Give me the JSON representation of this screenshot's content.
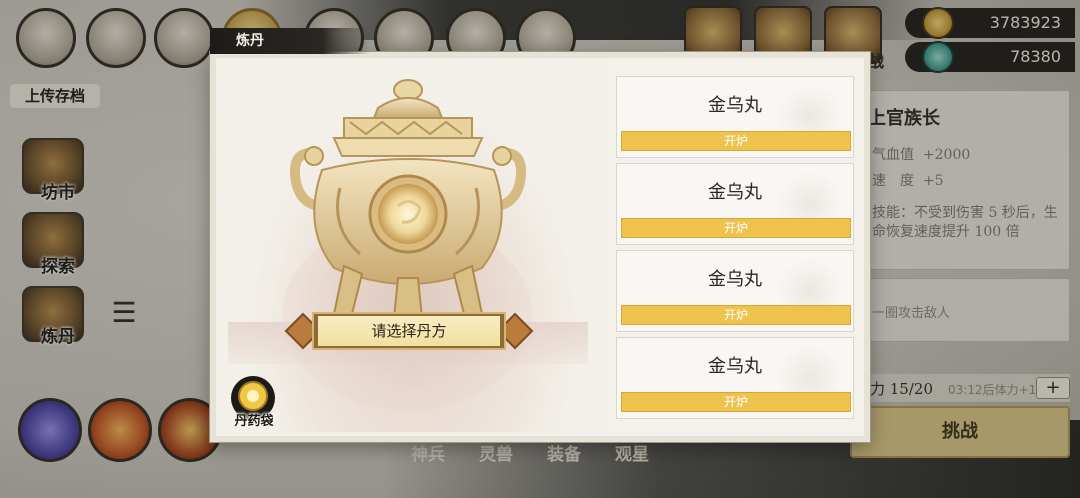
{
  "background": {
    "save_label": "上传存档",
    "side_menu": [
      {
        "label": "坊市",
        "icon": "market-icon"
      },
      {
        "label": "探索",
        "icon": "explore-icon"
      },
      {
        "label": "炼丹",
        "icon": "alchemy-icon"
      }
    ],
    "bottom_tabs": [
      "神兵",
      "灵兽",
      "装备",
      "观星"
    ],
    "currency": {
      "coins": "3783923",
      "jade": "78380"
    },
    "top_badge_text": "战",
    "character": {
      "title": "上官族长",
      "stats": [
        {
          "label": "气血值",
          "value": "+2000"
        },
        {
          "label": "速　度",
          "value": "+5"
        }
      ],
      "skill_text": "技能：不受到伤害 5 秒后，生命恢复速度提升 100 倍",
      "hint": "一圈攻击敌人"
    },
    "stamina": {
      "label": "力 15/20",
      "timer": "03:12后体力+1",
      "plus": "+"
    },
    "challenge_label": "挑战"
  },
  "modal": {
    "tab_title": "炼丹",
    "select_recipe_label": "请选择丹方",
    "bag_label": "丹药袋",
    "recipes": [
      {
        "name": "金乌丸",
        "button": "开炉"
      },
      {
        "name": "金乌丸",
        "button": "开炉"
      },
      {
        "name": "金乌丸",
        "button": "开炉"
      },
      {
        "name": "金乌丸",
        "button": "开炉"
      }
    ]
  },
  "colors": {
    "gold_button": "#edc34e",
    "banner_fill": "#f2df9f",
    "modal_bg": "#f4f1ea"
  }
}
